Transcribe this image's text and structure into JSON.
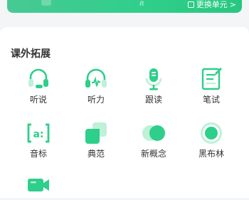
{
  "banner": {
    "switch_label": "更换单元",
    "chevron": ">"
  },
  "section": {
    "title": "课外拓展"
  },
  "items": [
    {
      "label": "听说",
      "icon": "headset-icon"
    },
    {
      "label": "听力",
      "icon": "headphones-icon"
    },
    {
      "label": "跟读",
      "icon": "microphone-icon"
    },
    {
      "label": "笔试",
      "icon": "notebook-pen-icon"
    },
    {
      "label": "音标",
      "icon": "phonetic-icon"
    },
    {
      "label": "典范",
      "icon": "cards-icon"
    },
    {
      "label": "新概念",
      "icon": "circles-icon"
    },
    {
      "label": "黑布林",
      "icon": "record-icon"
    },
    {
      "label": "",
      "icon": "video-camera-icon"
    }
  ],
  "colors": {
    "accent": "#2ecf8a",
    "accent_light": "#bff0d8",
    "text": "#333333",
    "background": "#f4f5f7"
  }
}
